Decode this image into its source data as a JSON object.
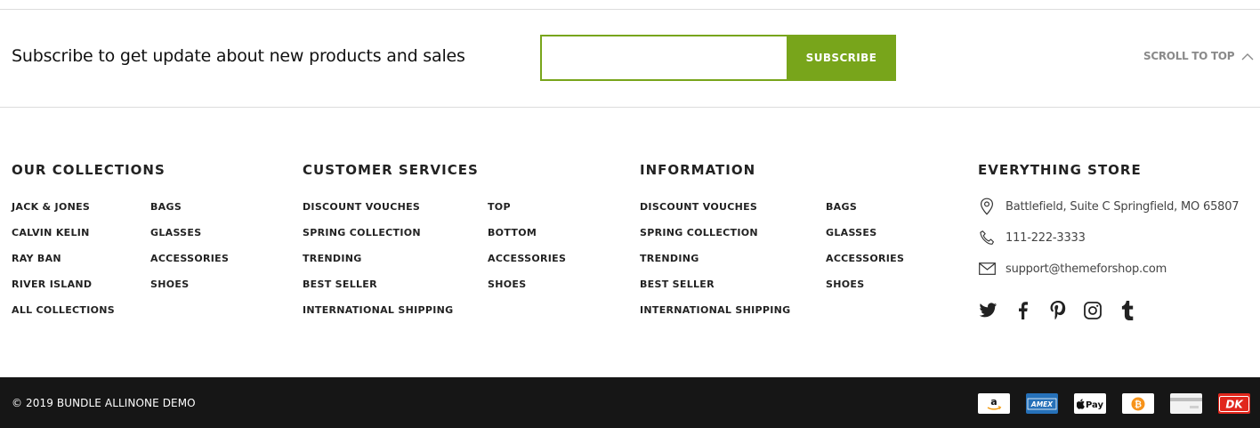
{
  "subscribe": {
    "heading": "Subscribe to get update about new products and sales",
    "input_placeholder": "",
    "button_label": "SUBSCRIBE",
    "accent_color": "#78a51b"
  },
  "scroll_top": {
    "label": "SCROLL TO TOP",
    "icon": "chevron-up-icon"
  },
  "our_collections": {
    "title": "OUR COLLECTIONS",
    "col1": [
      "JACK & JONES",
      "CALVIN KELIN",
      "RAY BAN",
      "RIVER ISLAND",
      "ALL COLLECTIONS"
    ],
    "col2": [
      "BAGS",
      "GLASSES",
      "ACCESSORIES",
      "SHOES"
    ]
  },
  "customer_services": {
    "title": "CUSTOMER SERVICES",
    "col1": [
      "DISCOUNT VOUCHES",
      "SPRING COLLECTION",
      "TRENDING",
      "BEST SELLER",
      "INTERNATIONAL SHIPPING"
    ],
    "col2": [
      "TOP",
      "BOTTOM",
      "ACCESSORIES",
      "SHOES"
    ]
  },
  "information": {
    "title": "INFORMATION",
    "col1": [
      "DISCOUNT VOUCHES",
      "SPRING COLLECTION",
      "TRENDING",
      "BEST SELLER",
      "INTERNATIONAL SHIPPING"
    ],
    "col2": [
      "BAGS",
      "GLASSES",
      "ACCESSORIES",
      "SHOES"
    ]
  },
  "store": {
    "title": "EVERYTHING STORE",
    "address": "Battlefield, Suite C Springfield, MO 65807",
    "phone": "111-222-3333",
    "email": "support@themeforshop.com",
    "social": [
      "twitter-icon",
      "facebook-icon",
      "pinterest-icon",
      "instagram-icon",
      "tumblr-icon"
    ]
  },
  "footer_bottom": {
    "copyright": "© 2019 BUNDLE ALLINONE DEMO",
    "payments": [
      "amazon-pay-icon",
      "amex-icon",
      "apple-pay-icon",
      "bitcoin-icon",
      "credit-card-icon",
      "dankort-icon"
    ],
    "background": "#161616"
  }
}
